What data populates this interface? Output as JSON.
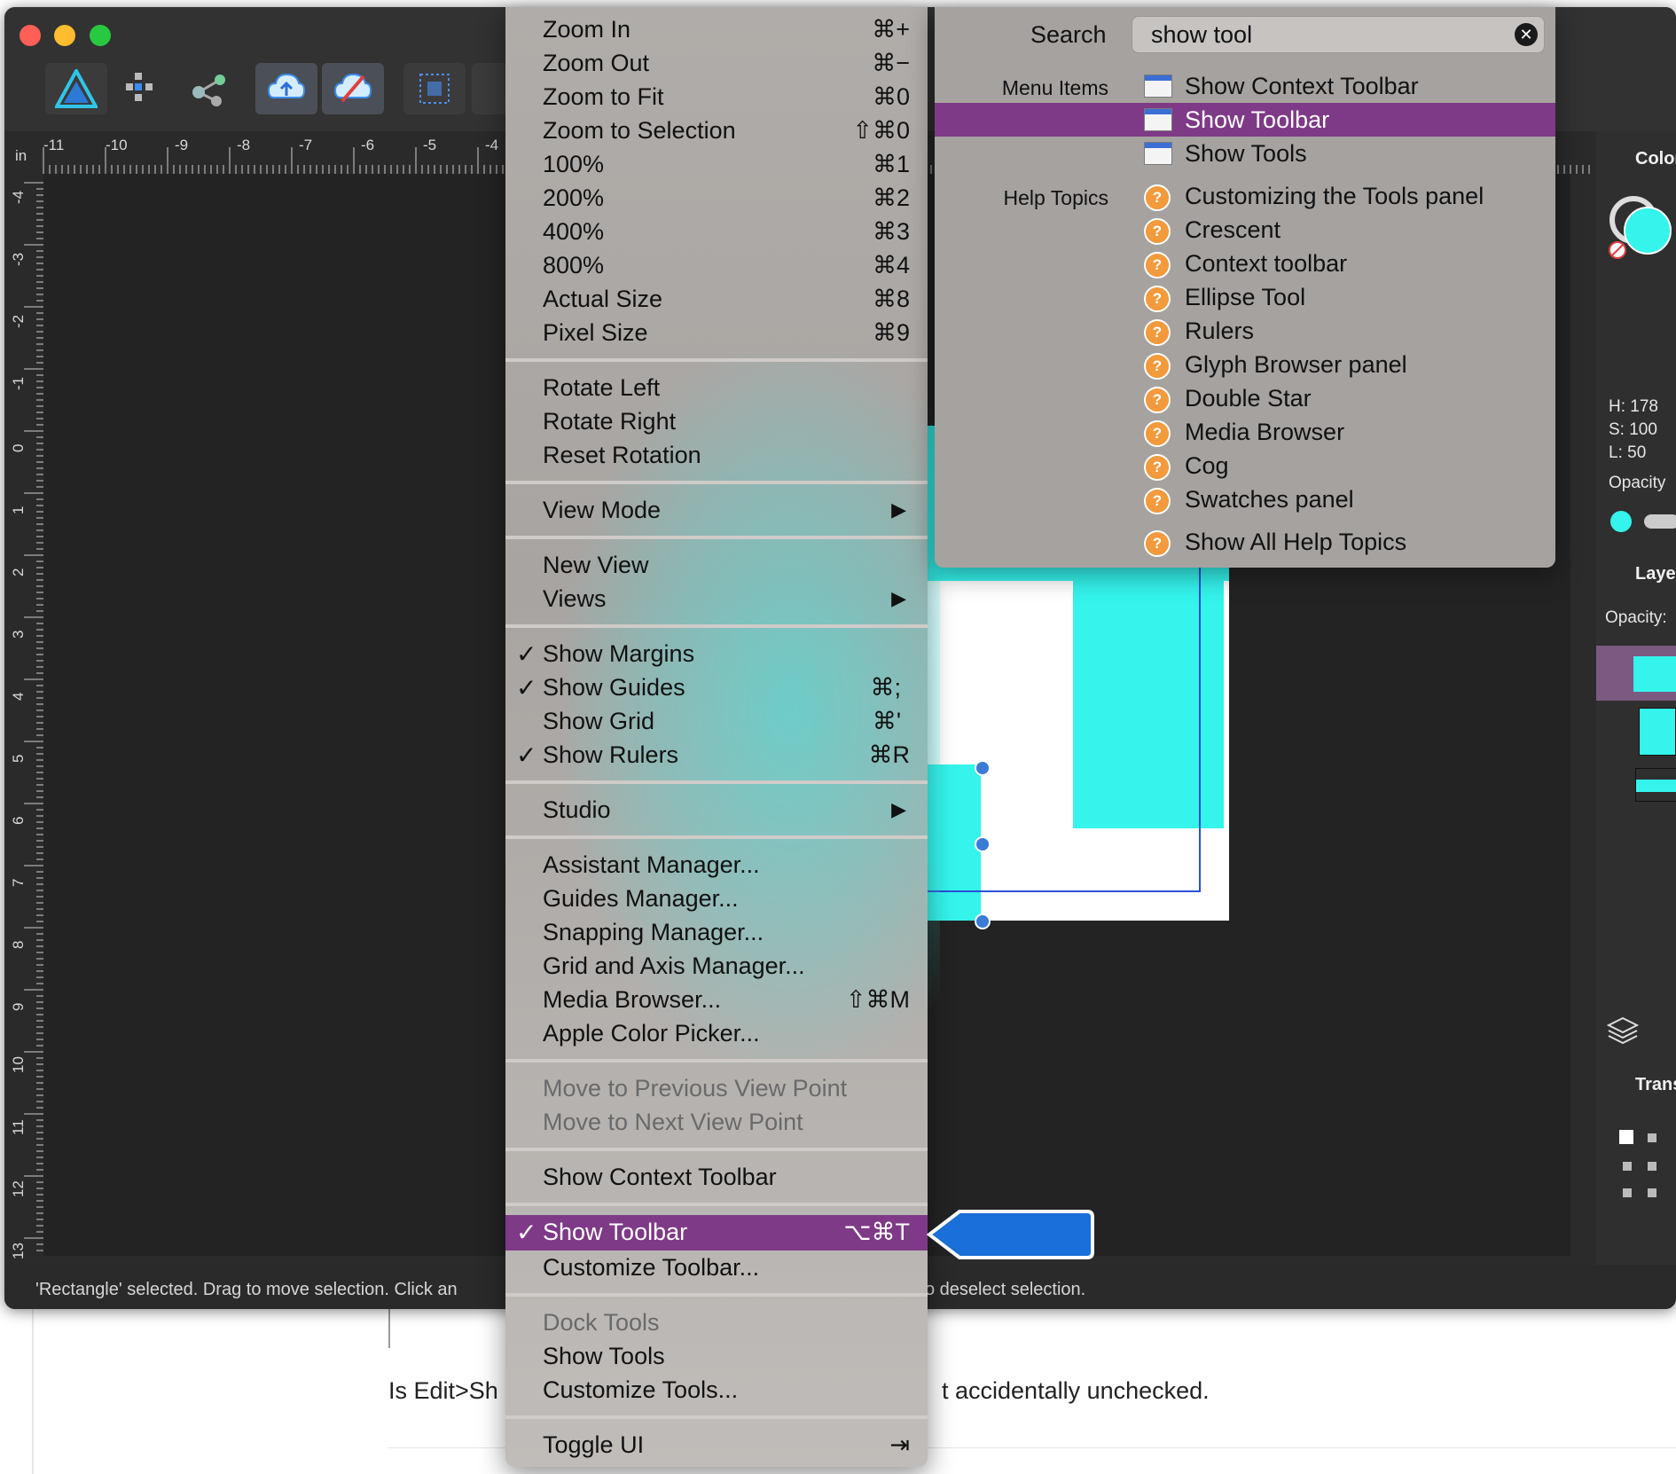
{
  "background_page": {
    "text_left": "Is  Edit>Sh",
    "text_right": "t accidentally unchecked."
  },
  "app": {
    "ruler_unit": "in",
    "ruler_h_ticks": [
      "-11",
      "-10",
      "-9",
      "-8",
      "-7",
      "-6",
      "-5",
      "-4"
    ],
    "ruler_v_ticks": [
      "-4",
      "-3",
      "-2",
      "-1",
      "0",
      "1",
      "2",
      "3",
      "4",
      "5",
      "6",
      "7",
      "8",
      "9",
      "10",
      "11",
      "12",
      "13"
    ],
    "status_left": "'Rectangle' selected. Drag to move selection. Click an",
    "status_right": "o deselect selection."
  },
  "studio": {
    "color_title": "Color",
    "h": "H: 178",
    "s": "S: 100",
    "l": "L: 50",
    "opacity_label": "Opacity",
    "layers_title": "Layer",
    "layers_opacity": "Opacity:",
    "transform_title": "Trans"
  },
  "view_menu": {
    "items": [
      {
        "label": "Zoom In",
        "shortcut": "⌘+"
      },
      {
        "label": "Zoom Out",
        "shortcut": "⌘−"
      },
      {
        "label": "Zoom to Fit",
        "shortcut": "⌘0"
      },
      {
        "label": "Zoom to Selection",
        "shortcut": "⇧⌘0"
      },
      {
        "label": "100%",
        "shortcut": "⌘1"
      },
      {
        "label": "200%",
        "shortcut": "⌘2"
      },
      {
        "label": "400%",
        "shortcut": "⌘3"
      },
      {
        "label": "800%",
        "shortcut": "⌘4"
      },
      {
        "label": "Actual Size",
        "shortcut": "⌘8"
      },
      {
        "label": "Pixel Size",
        "shortcut": "⌘9"
      },
      {
        "label": "Rotate Left",
        "shortcut": ""
      },
      {
        "label": "Rotate Right",
        "shortcut": ""
      },
      {
        "label": "Reset Rotation",
        "shortcut": ""
      },
      {
        "label": "View Mode",
        "shortcut": ""
      },
      {
        "label": "New View",
        "shortcut": ""
      },
      {
        "label": "Views",
        "shortcut": ""
      },
      {
        "label": "Show Margins",
        "shortcut": ""
      },
      {
        "label": "Show Guides",
        "shortcut": "⌘;"
      },
      {
        "label": "Show Grid",
        "shortcut": "⌘'"
      },
      {
        "label": "Show Rulers",
        "shortcut": "⌘R"
      },
      {
        "label": "Studio",
        "shortcut": ""
      },
      {
        "label": "Assistant Manager...",
        "shortcut": ""
      },
      {
        "label": "Guides Manager...",
        "shortcut": ""
      },
      {
        "label": "Snapping Manager...",
        "shortcut": ""
      },
      {
        "label": "Grid and Axis Manager...",
        "shortcut": ""
      },
      {
        "label": "Media Browser...",
        "shortcut": "⇧⌘M"
      },
      {
        "label": "Apple Color Picker...",
        "shortcut": ""
      },
      {
        "label": "Move to Previous View Point",
        "shortcut": ""
      },
      {
        "label": "Move to Next View Point",
        "shortcut": ""
      },
      {
        "label": "Show Context Toolbar",
        "shortcut": ""
      },
      {
        "label": "Show Toolbar",
        "shortcut": "⌥⌘T"
      },
      {
        "label": "Customize Toolbar...",
        "shortcut": ""
      },
      {
        "label": "Dock Tools",
        "shortcut": ""
      },
      {
        "label": "Show Tools",
        "shortcut": ""
      },
      {
        "label": "Customize Tools...",
        "shortcut": ""
      },
      {
        "label": "Toggle UI",
        "shortcut": "⇥"
      }
    ],
    "checkmark": "✓",
    "submenu_arrow": "▶"
  },
  "help_search": {
    "search_label": "Search",
    "query": "show tool",
    "clear_glyph": "✕",
    "menu_items_label": "Menu Items",
    "help_topics_label": "Help Topics",
    "menu_items": [
      "Show Context Toolbar",
      "Show Toolbar",
      "Show Tools"
    ],
    "help_topics": [
      "Customizing the Tools panel",
      "Crescent",
      "Context toolbar",
      "Ellipse Tool",
      "Rulers",
      "Glyph Browser panel",
      "Double Star",
      "Media Browser",
      "Cog",
      "Swatches panel"
    ],
    "show_all": "Show All Help Topics",
    "help_glyph": "?"
  },
  "colors": {
    "highlight": "#7e3a86",
    "accent_cyan": "#34f4ec",
    "callout_blue": "#1a6fd8"
  }
}
